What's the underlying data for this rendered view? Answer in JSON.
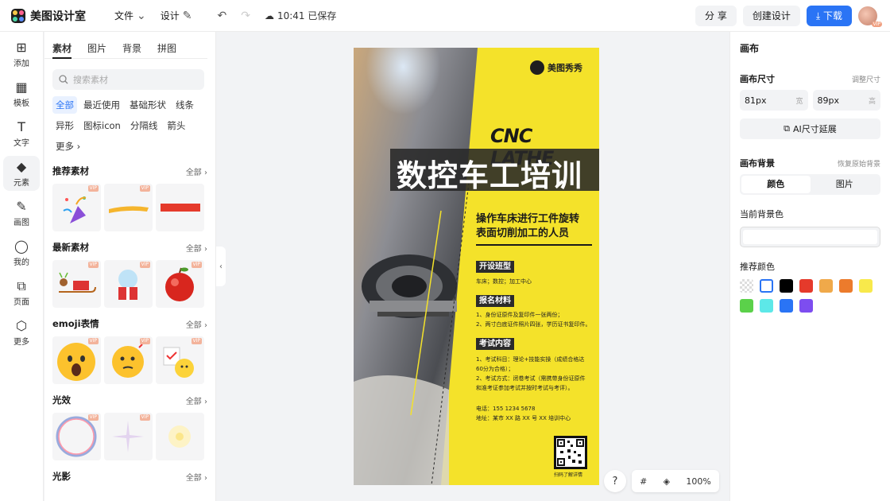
{
  "app": {
    "name": "美图设计室"
  },
  "topbar": {
    "file": "文件",
    "design": "设计",
    "saved": "10:41 已保存",
    "share": "分 享",
    "create": "创建设计",
    "download": "下载",
    "avatar_badge": "VIP"
  },
  "rail": {
    "items": [
      "添加",
      "模板",
      "文字",
      "元素",
      "画图",
      "我的",
      "页面",
      "更多"
    ],
    "active_index": 3
  },
  "panel": {
    "tabs": [
      "素材",
      "图片",
      "背景",
      "拼图"
    ],
    "search_placeholder": "搜索素材",
    "tags": [
      "全部",
      "最近使用",
      "基础形状",
      "线条",
      "异形",
      "图标icon",
      "分隔线",
      "箭头",
      "更多"
    ],
    "sections": [
      {
        "title": "推荐素材",
        "all": "全部"
      },
      {
        "title": "最新素材",
        "all": "全部"
      },
      {
        "title": "emoji表情",
        "all": "全部"
      },
      {
        "title": "光效",
        "all": "全部"
      },
      {
        "title": "光影",
        "all": "全部"
      }
    ],
    "vip": "VIP"
  },
  "poster": {
    "brand": "美图秀秀",
    "cnc": "CNC LATHE",
    "title": "数控车工培训",
    "subtitle_1": "操作车床进行工件旋转",
    "subtitle_2": "表面切削加工的人员",
    "s1_label": "开设班型",
    "s1_text": "车床；数控；加工中心",
    "s2_label": "报名材料",
    "s2_text_1": "1、身份证原件及复印件一张两份；",
    "s2_text_2": "2、两寸白底证件照片四张，学历证书复印件。",
    "s3_label": "考试内容",
    "s3_text_1": "1、考试科目：理论+技能实操（成绩合格达",
    "s3_text_2": "60分为合格）；",
    "s3_text_3": "2、考试方式：闭卷考试（需携带身份证原件",
    "s3_text_4": "和准考证参加考试并按时考试与考评）。",
    "contact_1": "电话：155 1234 5678",
    "contact_2": "地址：某市 XX 路 XX 号 XX 培训中心",
    "qr_caption": "扫码了解详情"
  },
  "right": {
    "title": "画布",
    "size_label": "画布尺寸",
    "size_adjust": "调整尺寸",
    "width_value": "81px",
    "width_unit": "宽",
    "height_value": "89px",
    "height_unit": "高",
    "ai_button": "AI尺寸延展",
    "bg_label": "画布背景",
    "bg_reset": "恢复原始背景",
    "seg_color": "颜色",
    "seg_image": "图片",
    "current_bg": "当前背景色",
    "recommended": "推荐颜色",
    "swatches": [
      "#ffffff",
      "#000000",
      "#e53a2b",
      "#f0a94a",
      "#ec7b2c",
      "#f8e94b",
      "#5bd14a",
      "#5de8e8",
      "#2a74f5",
      "#7d4df0"
    ]
  },
  "bottom": {
    "help": "?",
    "zoom": "100%"
  }
}
